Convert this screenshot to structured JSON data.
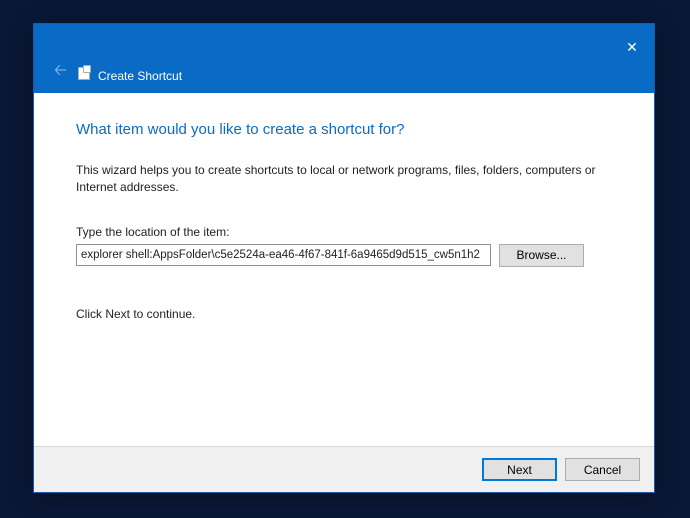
{
  "titlebar": {
    "title": "Create Shortcut"
  },
  "content": {
    "heading": "What item would you like to create a shortcut for?",
    "description": "This wizard helps you to create shortcuts to local or network programs, files, folders, computers or Internet addresses.",
    "field_label": "Type the location of the item:",
    "path_value": "explorer shell:AppsFolder\\c5e2524a-ea46-4f67-841f-6a9465d9d515_cw5n1h2",
    "browse_label": "Browse...",
    "next_hint": "Click Next to continue."
  },
  "buttons": {
    "next": "Next",
    "cancel": "Cancel"
  }
}
